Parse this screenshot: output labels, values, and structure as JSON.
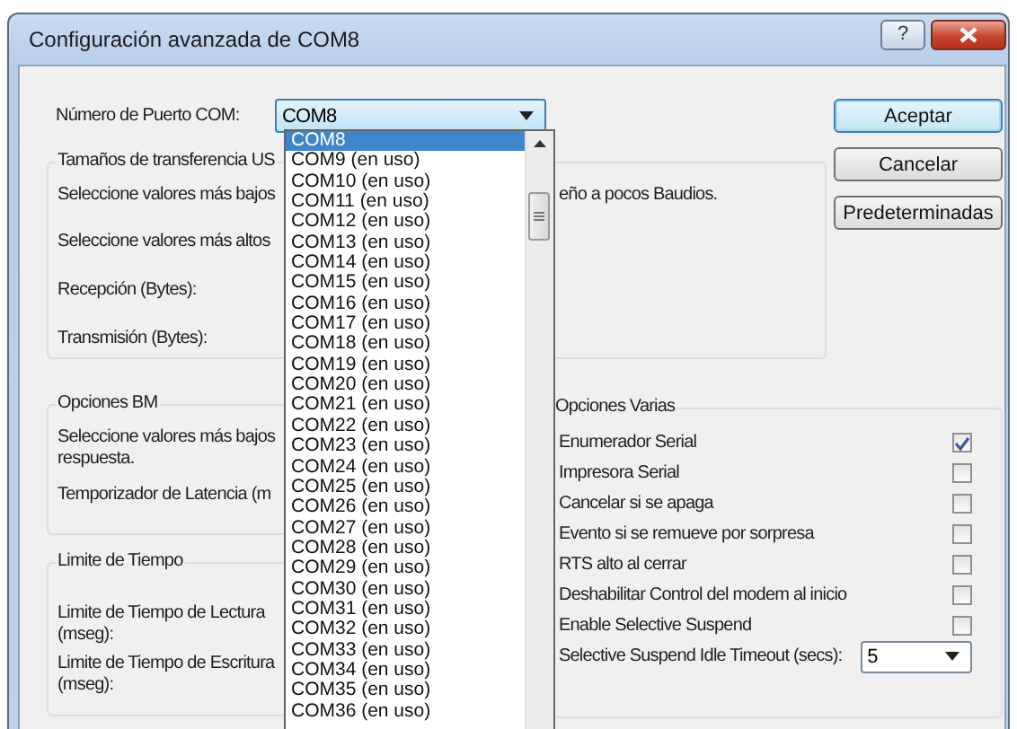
{
  "window": {
    "title": "Configuración avanzada de COM8",
    "help_button": "?"
  },
  "port": {
    "label": "Número de Puerto COM:",
    "value": "COM8",
    "options": [
      {
        "label": "COM8",
        "selected": true
      },
      {
        "label": "COM9 (en uso)",
        "selected": false
      },
      {
        "label": "COM10 (en uso)",
        "selected": false
      },
      {
        "label": "COM11 (en uso)",
        "selected": false
      },
      {
        "label": "COM12 (en uso)",
        "selected": false
      },
      {
        "label": "COM13 (en uso)",
        "selected": false
      },
      {
        "label": "COM14 (en uso)",
        "selected": false
      },
      {
        "label": "COM15 (en uso)",
        "selected": false
      },
      {
        "label": "COM16 (en uso)",
        "selected": false
      },
      {
        "label": "COM17 (en uso)",
        "selected": false
      },
      {
        "label": "COM18 (en uso)",
        "selected": false
      },
      {
        "label": "COM19 (en uso)",
        "selected": false
      },
      {
        "label": "COM20 (en uso)",
        "selected": false
      },
      {
        "label": "COM21 (en uso)",
        "selected": false
      },
      {
        "label": "COM22 (en uso)",
        "selected": false
      },
      {
        "label": "COM23 (en uso)",
        "selected": false
      },
      {
        "label": "COM24 (en uso)",
        "selected": false
      },
      {
        "label": "COM25 (en uso)",
        "selected": false
      },
      {
        "label": "COM26 (en uso)",
        "selected": false
      },
      {
        "label": "COM27 (en uso)",
        "selected": false
      },
      {
        "label": "COM28 (en uso)",
        "selected": false
      },
      {
        "label": "COM29 (en uso)",
        "selected": false
      },
      {
        "label": "COM30 (en uso)",
        "selected": false
      },
      {
        "label": "COM31 (en uso)",
        "selected": false
      },
      {
        "label": "COM32 (en uso)",
        "selected": false
      },
      {
        "label": "COM33 (en uso)",
        "selected": false
      },
      {
        "label": "COM34 (en uso)",
        "selected": false
      },
      {
        "label": "COM35 (en uso)",
        "selected": false
      },
      {
        "label": "COM36 (en uso)",
        "selected": false
      }
    ]
  },
  "buttons": [
    {
      "label": "Aceptar",
      "default": true
    },
    {
      "label": "Cancelar",
      "default": false
    },
    {
      "label": "Predeterminadas",
      "default": false
    }
  ],
  "transfer_group": {
    "title": "Tamaños de transferencia US",
    "rows": [
      {
        "text": "Seleccione valores más bajos",
        "text_right": "eño a pocos Baudios."
      },
      {
        "text": "Seleccione valores más altos"
      },
      {
        "text": "Recepción (Bytes):"
      },
      {
        "text": "Transmisión (Bytes):"
      }
    ]
  },
  "bm_group": {
    "title": "Opciones BM",
    "rows": [
      {
        "lines": [
          "Seleccione valores más bajos",
          "respuesta."
        ]
      },
      {
        "lines": [
          "Temporizador de Latencia (m"
        ]
      }
    ]
  },
  "timeout_group": {
    "title": "Limite de Tiempo",
    "rows": [
      {
        "lines": [
          "Limite de Tiempo de Lectura",
          "(mseg):"
        ]
      },
      {
        "lines": [
          "Limite de Tiempo de Escritura",
          "(mseg):"
        ]
      }
    ]
  },
  "misc_group": {
    "title": "Opciones Varias",
    "items": [
      {
        "kind": "checkbox",
        "label": "Enumerador Serial",
        "checked": true
      },
      {
        "kind": "checkbox",
        "label": "Impresora Serial",
        "checked": false
      },
      {
        "kind": "checkbox",
        "label": "Cancelar si se apaga",
        "checked": false
      },
      {
        "kind": "checkbox",
        "label": "Evento si se remueve por sorpresa",
        "checked": false
      },
      {
        "kind": "checkbox",
        "label": "RTS alto al cerrar",
        "checked": false
      },
      {
        "kind": "checkbox",
        "label": "Deshabilitar Control del modem al inicio",
        "checked": false
      },
      {
        "kind": "checkbox",
        "label": "Enable Selective Suspend",
        "checked": false
      },
      {
        "kind": "select",
        "label": "Selective Suspend Idle Timeout (secs):",
        "value": "5"
      }
    ]
  }
}
